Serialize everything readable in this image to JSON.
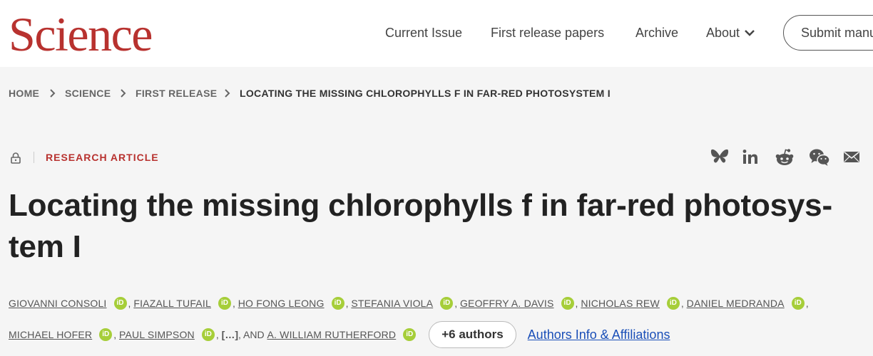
{
  "header": {
    "logo": "Science",
    "nav": [
      "Current Issue",
      "First release papers",
      "Archive",
      "About"
    ],
    "submit_label": "Submit manuscript"
  },
  "breadcrumb": [
    "HOME",
    "SCIENCE",
    "FIRST RELEASE",
    "LOCATING THE MISSING CHLOROPHYLLS F IN FAR-RED PHOTOSYSTEM I"
  ],
  "article": {
    "type": "RESEARCH ARTICLE",
    "title": "Locating the missing chlorophylls f in far-red photosys-tem I",
    "title_line1": "Locating the missing chlorophylls f in far-red photosys-",
    "title_line2": "tem I",
    "share_icons": [
      "bluesky-icon",
      "linkedin-icon",
      "reddit-icon",
      "wechat-icon",
      "email-icon"
    ],
    "authors": [
      "GIOVANNI CONSOLI",
      "FIAZALL TUFAIL",
      "HO FONG LEONG",
      "STEFANIA VIOLA",
      "GEOFFRY A. DAVIS",
      "NICHOLAS REW",
      "DANIEL MEDRANDA",
      "MICHAEL HOFER",
      "PAUL SIMPSON",
      "A. WILLIAM RUTHERFORD"
    ],
    "orcid_label": "iD",
    "ellipsis": "[…]",
    "and_text": ", AND",
    "more_authors": "+6 authors",
    "affiliations_link": "Authors Info & Affiliations"
  },
  "colors": {
    "brand": "#b8322f",
    "orcid": "#a6ce39",
    "link": "#1a4fb8"
  }
}
